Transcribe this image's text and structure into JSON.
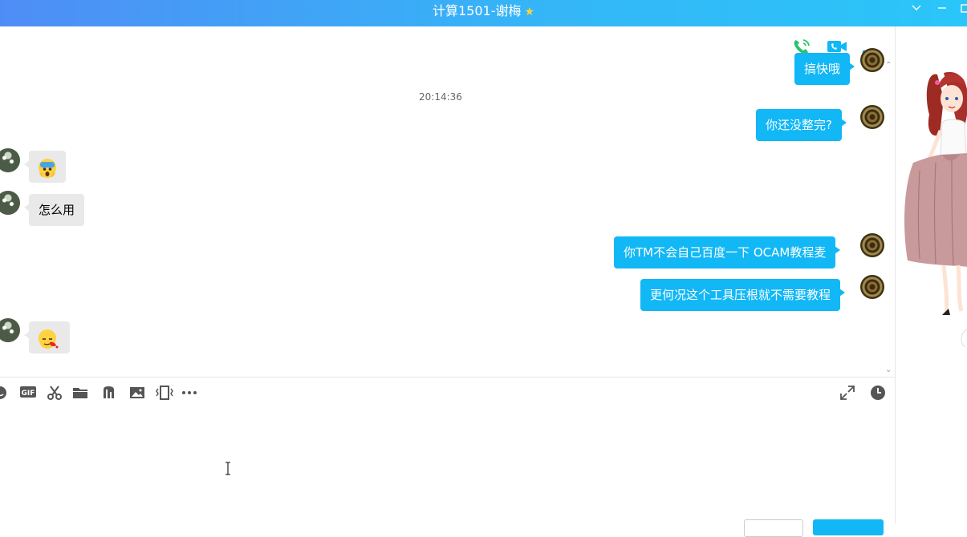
{
  "window": {
    "title": "计算1501-谢梅",
    "title_badge_icon": "star-icon",
    "controls": [
      "chevron-down-icon",
      "minimize-icon",
      "maximize-icon"
    ]
  },
  "header_actions": [
    {
      "name": "voice-call-icon",
      "color": "#2bc36b"
    },
    {
      "name": "video-call-icon",
      "color": "#12b7f5"
    },
    {
      "name": "more-options-icon",
      "color": "#12b7f5"
    }
  ],
  "messages": {
    "m0": {
      "sender": "me",
      "text": "搞快哦"
    },
    "time1": "20:14:36",
    "m1": {
      "sender": "me",
      "text": "你还没整完?"
    },
    "m2": {
      "sender": "them",
      "emoji": "scream-emoji"
    },
    "m3": {
      "sender": "them",
      "text": "怎么用"
    },
    "m4": {
      "sender": "me",
      "text": "你TM不会自己百度一下 OCAM教程麦"
    },
    "m5": {
      "sender": "me",
      "text": "更何况这个工具压根就不需要教程"
    },
    "m6": {
      "sender": "them",
      "emoji": "nosebleed-emoji"
    }
  },
  "toolbar": {
    "gif_label": "GIF",
    "icons": [
      "emoji-icon",
      "gif-icon",
      "scissors-icon",
      "folder-icon",
      "music-icon",
      "image-icon",
      "shake-window-icon",
      "more-icon"
    ],
    "right_icons": [
      "expand-icon",
      "history-clock-icon"
    ]
  },
  "colors": {
    "accent": "#12b7f5",
    "bubble_other": "#e9e9e9",
    "title_start": "#4f8df6",
    "title_end": "#2ac6f9"
  }
}
